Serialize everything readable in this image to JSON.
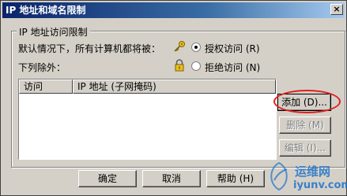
{
  "window": {
    "title": "IP 地址和域名限制",
    "close_glyph": "×"
  },
  "group": {
    "title": "IP 地址访问限制",
    "default_text": "默认情况下，所有计算机都将被：",
    "except_text": "下列除外：",
    "grant_label": "授权访问 (R)",
    "deny_label": "拒绝访问 (N)",
    "selected": "grant"
  },
  "list": {
    "columns": [
      "访问",
      "IP 地址 (子网掩码)"
    ],
    "rows": []
  },
  "buttons": {
    "add": "添加 (D)...",
    "remove": "删除 (M)",
    "edit": "编辑 (I)...",
    "ok": "确定",
    "cancel": "取消",
    "help": "帮助 (H)"
  },
  "watermark": {
    "cn": "运维网",
    "url": "iyunv.com"
  },
  "colors": {
    "highlight": "#e02020",
    "titlebar_start": "#0a246a",
    "watermark_blue": "#1e73c8"
  }
}
